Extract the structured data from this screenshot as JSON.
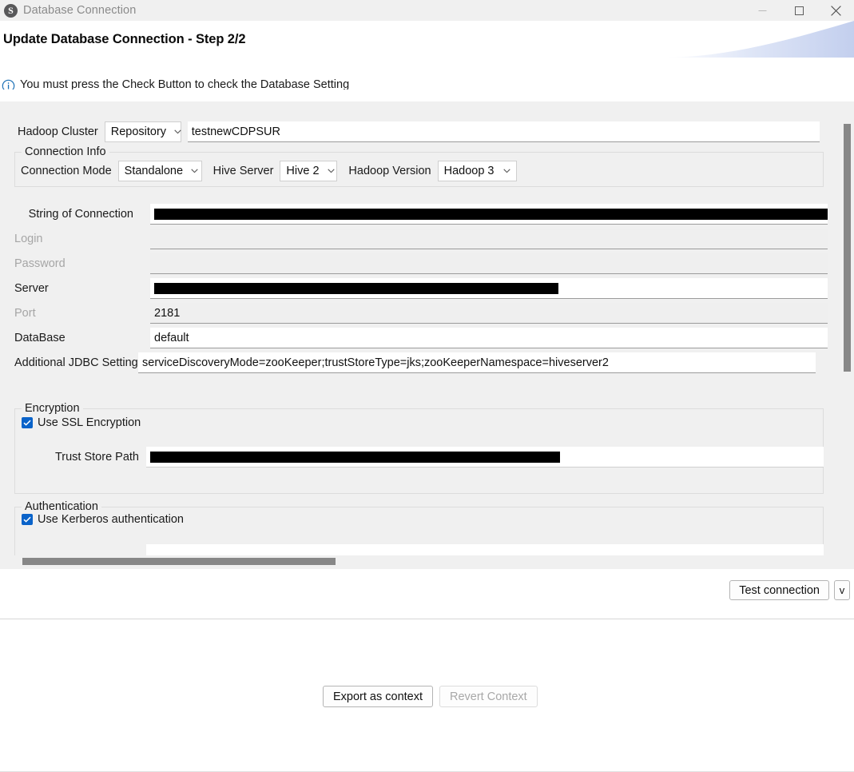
{
  "window": {
    "title": "Database Connection",
    "logo_glyph": "S",
    "controls": [
      {
        "name": "minimize",
        "label": "—"
      },
      {
        "name": "maximize",
        "label": "□"
      },
      {
        "name": "close",
        "label": "✕"
      }
    ]
  },
  "header": {
    "page_title": "Update Database Connection - Step 2/2",
    "hint": "You must press the Check Button to check the Database Setting"
  },
  "form": {
    "cluster": {
      "label": "Hadoop Cluster",
      "mode_value": "Repository",
      "name_value": "testnewCDPSUR"
    },
    "connection_info": {
      "title": "Connection Info",
      "connection_mode_label": "Connection Mode",
      "connection_mode_value": "Standalone",
      "hive_server_label": "Hive Server",
      "hive_server_value": "Hive 2",
      "hadoop_version_label": "Hadoop Version",
      "hadoop_version_value": "Hadoop 3"
    },
    "fields": [
      {
        "label": "String of Connection",
        "value": "",
        "redacted": true,
        "disabled": false
      },
      {
        "label": "Login",
        "value": "",
        "redacted": false,
        "disabled": true
      },
      {
        "label": "Password",
        "value": "",
        "redacted": false,
        "disabled": true
      },
      {
        "label": "Server",
        "value": "",
        "redacted": true,
        "disabled": false
      },
      {
        "label": "Port",
        "value": "2181",
        "redacted": false,
        "disabled": true
      },
      {
        "label": "DataBase",
        "value": "default",
        "redacted": false,
        "disabled": false
      },
      {
        "label": "Additional JDBC Settings",
        "value": "serviceDiscoveryMode=zooKeeper;trustStoreType=jks;zooKeeperNamespace=hiveserver2",
        "redacted": false,
        "disabled": false
      }
    ],
    "encryption": {
      "title": "Encryption",
      "ssl_label": "Use SSL Encryption",
      "ssl_checked": true,
      "trust_store_label": "Trust Store Path",
      "trust_store_value": "",
      "trust_store_redacted": true
    },
    "authentication": {
      "title": "Authentication",
      "kerberos_label": "Use Kerberos authentication",
      "kerberos_checked": true
    }
  },
  "actions": {
    "test_connection_label": "Test connection",
    "test_connection_arrow": "v",
    "export_label": "Export as context",
    "revert_label": "Revert Context"
  },
  "colors": {
    "accent": "#0a63c9",
    "info": "#1a6fb5",
    "panel": "#f0f0f0",
    "redaction": "#000000",
    "scrollbar": "#878787"
  }
}
